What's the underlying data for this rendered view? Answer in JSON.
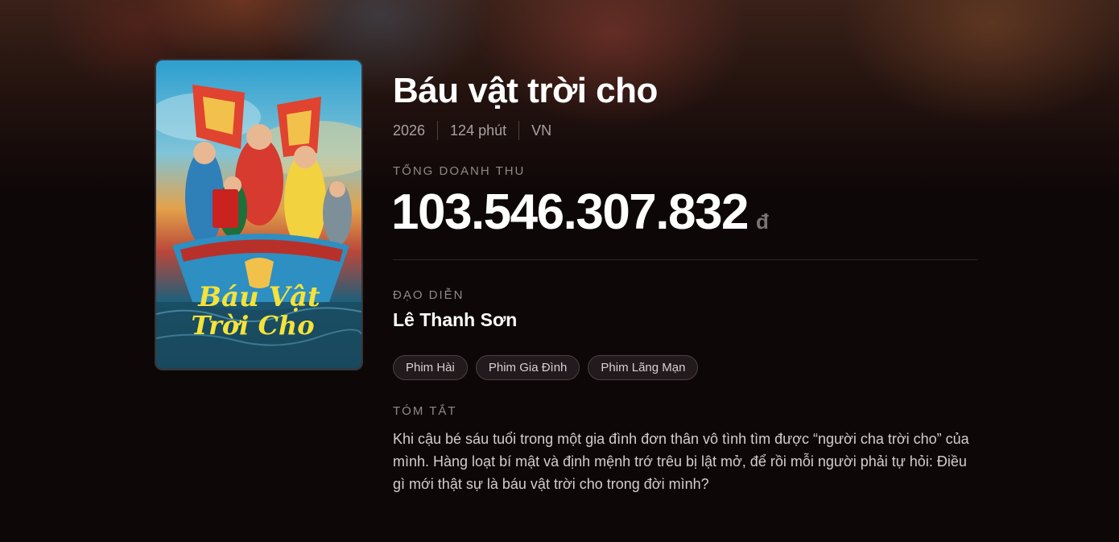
{
  "movie": {
    "title": "Báu vật trời cho",
    "year": "2026",
    "duration": "124 phút",
    "country": "VN",
    "poster_title_line1": "Báu Vật",
    "poster_title_line2": "Trời Cho"
  },
  "revenue": {
    "label": "TỔNG DOANH THU",
    "amount": "103.546.307.832",
    "currency": "đ"
  },
  "director": {
    "label": "ĐẠO DIỄN",
    "name": "Lê Thanh Sơn"
  },
  "genres": [
    "Phim Hài",
    "Phim Gia Đình",
    "Phim Lãng Mạn"
  ],
  "summary": {
    "label": "TÓM TẮT",
    "text": "Khi cậu bé sáu tuổi trong một gia đình đơn thân vô tình tìm được “người cha trời cho” của mình. Hàng loạt bí mật và định mệnh trớ trêu bị lật mở, để rồi mỗi người phải tự hỏi: Điều gì mới thật sự là báu vật trời cho trong đời mình?"
  },
  "colors": {
    "background": "#0e0708",
    "poster_title": "#f5e23a",
    "chip_border": "#4a4244"
  }
}
